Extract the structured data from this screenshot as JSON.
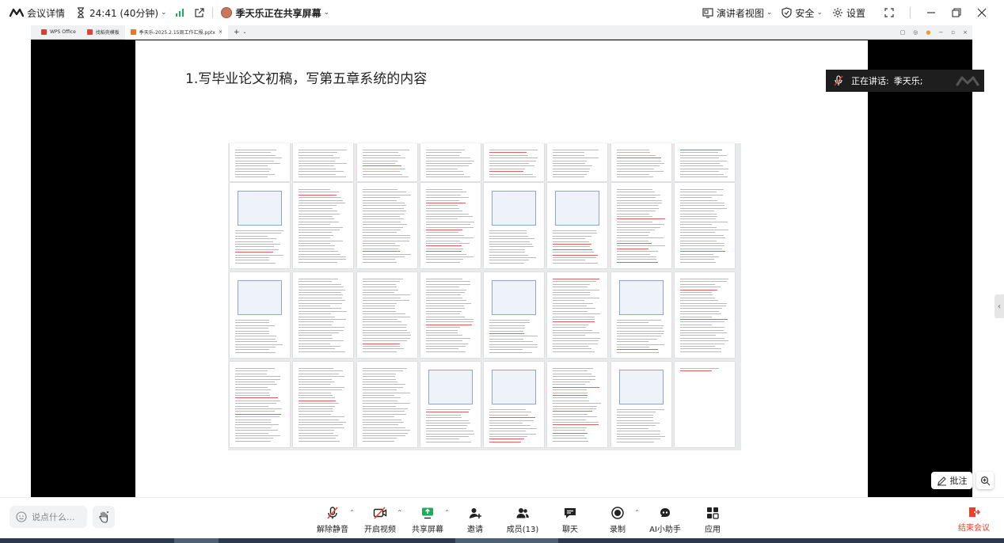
{
  "topbar": {
    "meeting_details": "会议详情",
    "timer": "24:41 (40分钟)",
    "sharer": "季天乐正在共享屏幕",
    "presenter_view": "演讲者视图",
    "security": "安全",
    "settings": "设置"
  },
  "shared_window": {
    "tabs": [
      {
        "label": "WPS Office",
        "color": "#d6402d"
      },
      {
        "label": "找稻壳模板",
        "color": "#e0443a"
      },
      {
        "label": "季天乐-2025.2.15周工作汇报.pptx",
        "color": "#e8762c"
      }
    ],
    "tab_close": "×",
    "tab_add": "+"
  },
  "slide": {
    "title": "1.写毕业论文初稿，写第五章系统的内容"
  },
  "speaking": {
    "label": "正在讲话:",
    "name": "季天乐;"
  },
  "annotate_label": "批注",
  "bottombar": {
    "chat_placeholder": "说点什么...",
    "tools": [
      {
        "label": "解除静音",
        "icon": "mic-muted-icon"
      },
      {
        "label": "开启视频",
        "icon": "video-off-icon"
      },
      {
        "label": "共享屏幕",
        "icon": "share-screen-icon"
      },
      {
        "label": "邀请",
        "icon": "invite-icon"
      },
      {
        "label": "成员(13)",
        "icon": "members-icon"
      },
      {
        "label": "聊天",
        "icon": "chat-icon"
      },
      {
        "label": "录制",
        "icon": "record-icon"
      },
      {
        "label": "AI小助手",
        "icon": "ai-assistant-icon"
      },
      {
        "label": "应用",
        "icon": "apps-icon"
      }
    ],
    "end_meeting": "结束会议"
  },
  "colors": {
    "accent_green": "#1aad5b",
    "end_red": "#e8412c",
    "share_green": "#1aad5b"
  }
}
